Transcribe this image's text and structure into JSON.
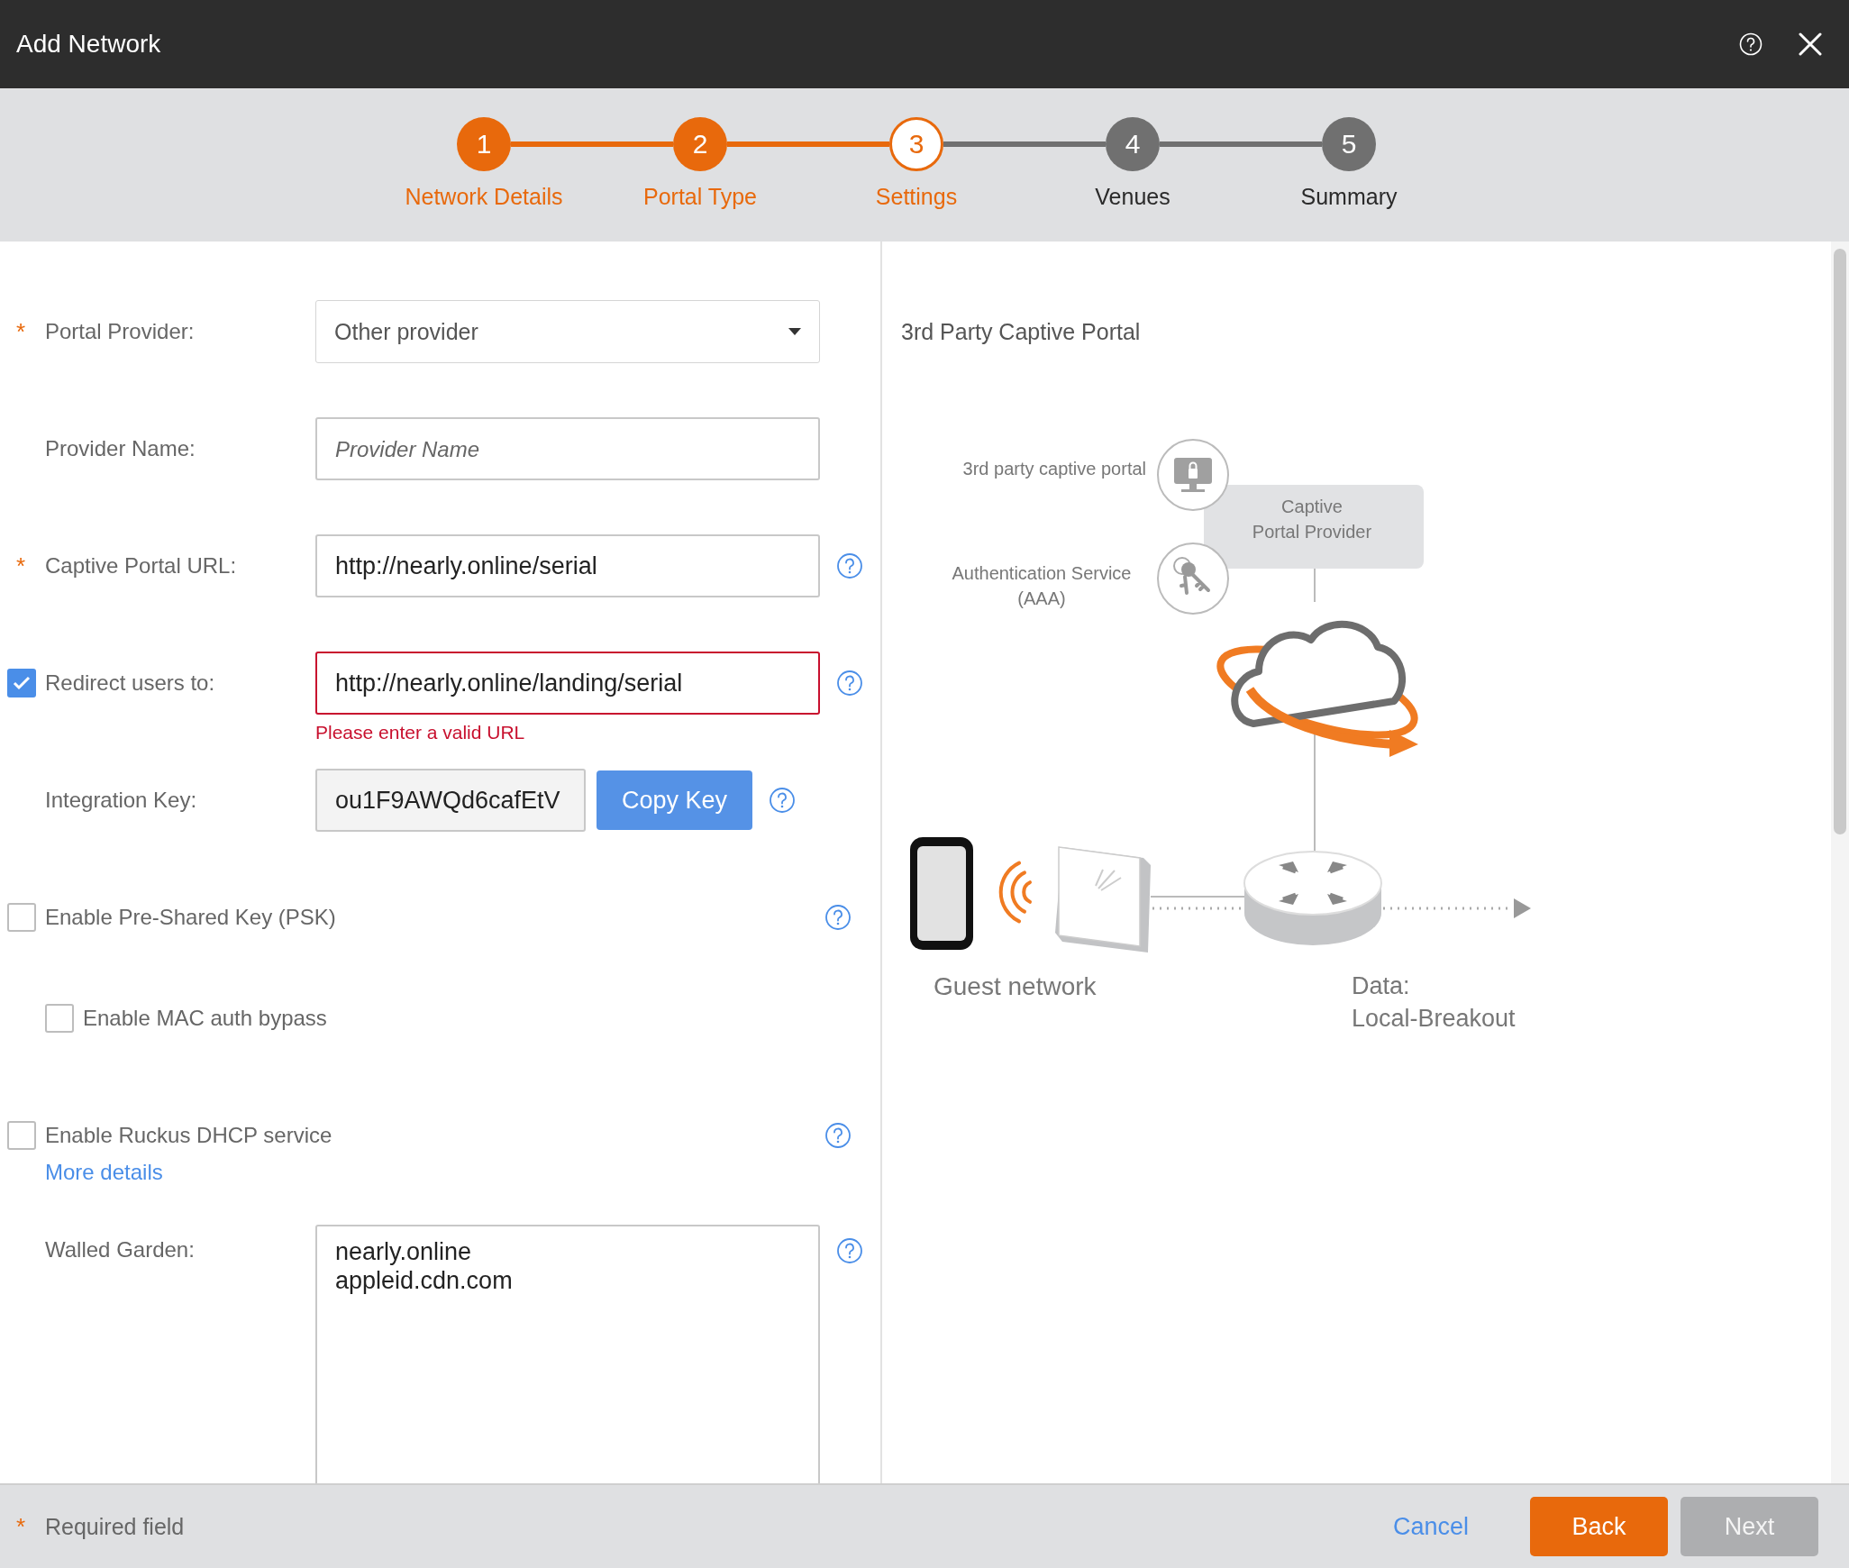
{
  "window": {
    "title": "Add Network"
  },
  "steps": [
    {
      "number": "1",
      "label": "Network Details",
      "done": true,
      "selected": false
    },
    {
      "number": "2",
      "label": "Portal Type",
      "done": true,
      "selected": false
    },
    {
      "number": "3",
      "label": "Settings",
      "done": false,
      "selected": true
    },
    {
      "number": "4",
      "label": "Venues",
      "done": false,
      "selected": false
    },
    {
      "number": "5",
      "label": "Summary",
      "done": false,
      "selected": false
    }
  ],
  "form": {
    "fields": [
      {
        "kind": "select",
        "required_mark": "*",
        "label": "Portal Provider:",
        "value": "Other provider"
      },
      {
        "kind": "text",
        "label": "Provider Name:",
        "placeholder": "Provider Name"
      },
      {
        "kind": "text",
        "required_mark": "*",
        "label": "Captive Portal URL:",
        "value": "http://nearly.online/serial",
        "help": true
      },
      {
        "kind": "checked-text",
        "label": "Redirect users to:",
        "checked": true,
        "value": "http://nearly.online/landing/serial",
        "invalid": true,
        "error": "Please enter a valid URL",
        "help": true
      },
      {
        "kind": "key",
        "label": "Integration Key:",
        "value": "ou1F9AWQd6cafEtV",
        "button": "Copy Key",
        "help": true
      },
      {
        "kind": "checkbox",
        "label": "Enable Pre-Shared Key (PSK)",
        "checked": false,
        "help": true,
        "children": [
          {
            "kind": "checkbox",
            "label": "Enable MAC auth bypass",
            "checked": false
          }
        ]
      },
      {
        "kind": "checkbox",
        "label": "Enable Ruckus DHCP service",
        "checked": false,
        "help": true,
        "link": "More details"
      },
      {
        "kind": "textarea",
        "label": "Walled Garden:",
        "value": "nearly.online\nappleid.cdn.com",
        "help": true
      }
    ]
  },
  "diagram_panel": {
    "title": "3rd Party Captive Portal",
    "portal_label": "3rd party captive portal",
    "provider_box": [
      "Captive",
      "Portal Provider"
    ],
    "auth_label": [
      "Authentication Service",
      "(AAA)"
    ],
    "guest_label": "Guest network",
    "data_label": [
      "Data:",
      "Local-Breakout"
    ]
  },
  "footer": {
    "required_mark": "*",
    "required_note": "Required field",
    "buttons": [
      {
        "label": "Cancel",
        "kind": "link",
        "disabled": false
      },
      {
        "label": "Back",
        "kind": "primary",
        "disabled": false
      },
      {
        "label": "Next",
        "kind": "secondary",
        "disabled": true
      }
    ]
  }
}
